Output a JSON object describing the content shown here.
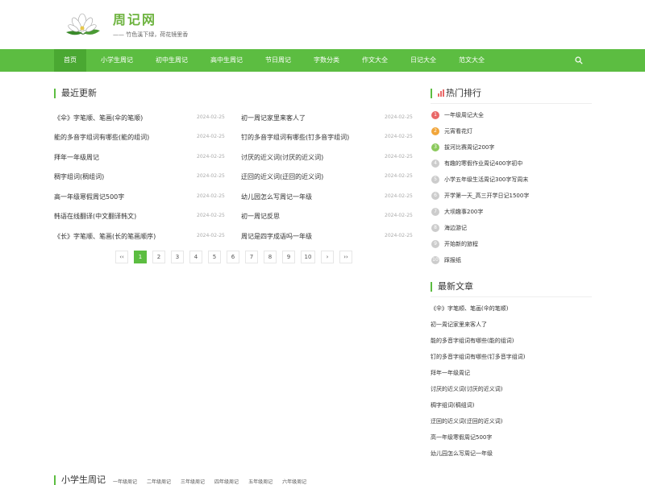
{
  "site": {
    "brand": "周记网",
    "slogan": "—— 竹色溪下绿，荷花镜里香"
  },
  "nav": {
    "items": [
      "首页",
      "小学生周记",
      "初中生周记",
      "高中生周记",
      "节日周记",
      "字数分类",
      "作文大全",
      "日记大全",
      "范文大全"
    ]
  },
  "latest": {
    "title": "最近更新",
    "left": [
      {
        "title": "《伞》字笔顺、笔画(伞的笔顺)",
        "date": "2024-02-25"
      },
      {
        "title": "能的多音字组词有哪些(能的组词)",
        "date": "2024-02-25"
      },
      {
        "title": "拜年一年级周记",
        "date": "2024-02-25"
      },
      {
        "title": "稠字组词(稠组词)",
        "date": "2024-02-25"
      },
      {
        "title": "高一年级寒假周记500字",
        "date": "2024-02-25"
      },
      {
        "title": "韩语在线翻译(中文翻译韩文)",
        "date": "2024-02-25"
      },
      {
        "title": "《长》字笔顺、笔画(长的笔画顺序)",
        "date": "2024-02-25"
      }
    ],
    "right": [
      {
        "title": "初一周记家里来客人了",
        "date": "2024-02-25"
      },
      {
        "title": "钉的多音字组词有哪些(钉多音字组词)",
        "date": "2024-02-25"
      },
      {
        "title": "讨厌的近义词(讨厌的近义词)",
        "date": "2024-02-25"
      },
      {
        "title": "迂回的近义词(迂回的近义词)",
        "date": "2024-02-25"
      },
      {
        "title": "幼儿园怎么写周记一年级",
        "date": "2024-02-25"
      },
      {
        "title": "初一周记反思",
        "date": "2024-02-25"
      },
      {
        "title": "周记是四字成语吗一年级",
        "date": "2024-02-25"
      }
    ]
  },
  "pager": [
    "‹‹",
    "1",
    "2",
    "3",
    "4",
    "5",
    "6",
    "7",
    "8",
    "9",
    "10",
    "›",
    "››"
  ],
  "hot": {
    "title": "热门排行",
    "items": [
      {
        "rank": "1",
        "title": "一年级周记大全"
      },
      {
        "rank": "2",
        "title": "元宵看花灯"
      },
      {
        "rank": "3",
        "title": "拔河比赛周记200字"
      },
      {
        "rank": "4",
        "title": "有趣的寒假作业周记400字初中"
      },
      {
        "rank": "5",
        "title": "小学五年级生活周记300字写周末"
      },
      {
        "rank": "6",
        "title": "开学第一天_高三开学日记1500字"
      },
      {
        "rank": "7",
        "title": "大坝趣事200字"
      },
      {
        "rank": "8",
        "title": "海边游记"
      },
      {
        "rank": "9",
        "title": "开始新的旅程"
      },
      {
        "rank": "10",
        "title": "踩报纸"
      }
    ]
  },
  "recent": {
    "title": "最新文章",
    "items": [
      "《伞》字笔顺、笔画(伞的笔顺)",
      "初一周记家里来客人了",
      "能的多音字组词有哪些(能的组词)",
      "钉的多音字组词有哪些(钉多音字组词)",
      "拜年一年级周记",
      "讨厌的近义词(讨厌的近义词)",
      "稠字组词(稠组词)",
      "迂回的近义词(迂回的近义词)",
      "高一年级寒假周记500字",
      "幼儿园怎么写周记一年级"
    ]
  },
  "bottom": {
    "title": "小学生周记",
    "links": [
      "一年级周记",
      "二年级周记",
      "三年级周记",
      "四年级周记",
      "五年级周记",
      "六年级周记"
    ]
  },
  "colors": {
    "accent": "#5cbd41",
    "rank1": "#e96868",
    "rank2": "#f1a53a",
    "rank3": "#8bc95c"
  },
  "icons": {
    "logo": "lotus-logo",
    "search": "search-icon"
  }
}
